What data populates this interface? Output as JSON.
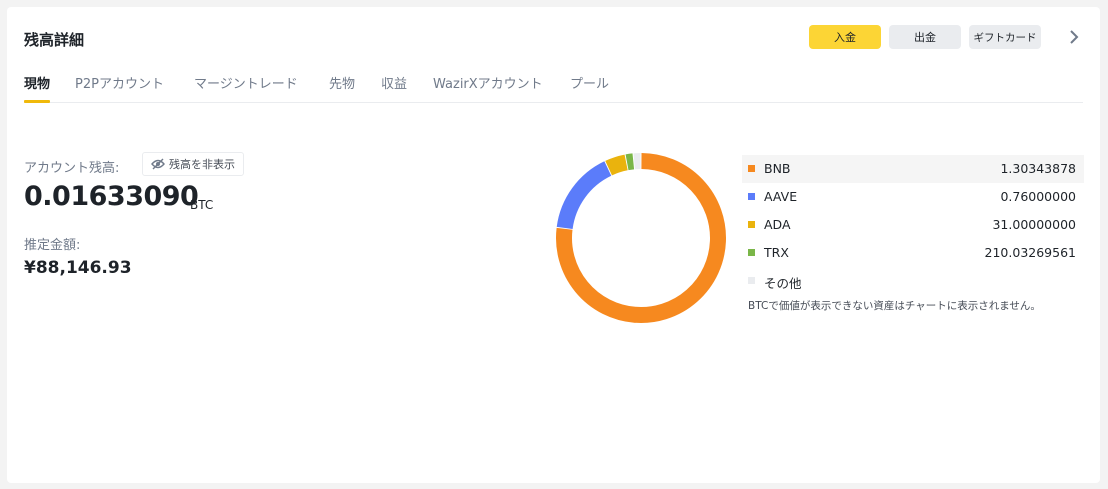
{
  "header": {
    "title": "残高詳細",
    "deposit_label": "入金",
    "withdraw_label": "出金",
    "gift_label": "ギフトカード",
    "more_icon": "chevron-right-icon"
  },
  "tabs": [
    {
      "label": "現物",
      "active": true
    },
    {
      "label": "P2Pアカウント",
      "active": false
    },
    {
      "label": "マージントレード",
      "active": false
    },
    {
      "label": "先物",
      "active": false
    },
    {
      "label": "収益",
      "active": false
    },
    {
      "label": "WazirXアカウント",
      "active": false
    },
    {
      "label": "プール",
      "active": false
    }
  ],
  "balance": {
    "label": "アカウント残高:",
    "hide_label": "残高を非表示",
    "hide_icon": "eye-off-icon",
    "amount": "0.01633090",
    "unit": "BTC",
    "estimate_label": "推定金額:",
    "estimate_value": "¥88,146.93"
  },
  "chart_data": {
    "type": "pie",
    "style": "donut",
    "categories": [
      "BNB",
      "AAVE",
      "ADA",
      "TRX",
      "その他"
    ],
    "values": [
      1.30343878,
      0.76,
      31.0,
      210.03269561,
      null
    ],
    "share_percent": [
      77,
      16,
      4,
      1.5,
      1.5
    ],
    "colors": [
      "#f6891f",
      "#5b7cfa",
      "#eab30d",
      "#7ab648",
      "#eaecef"
    ],
    "display_values": [
      "1.30343878",
      "0.76000000",
      "31.00000000",
      "210.03269561",
      ""
    ]
  },
  "note": "BTCで価値が表示できない資産はチャートに表示されません。"
}
